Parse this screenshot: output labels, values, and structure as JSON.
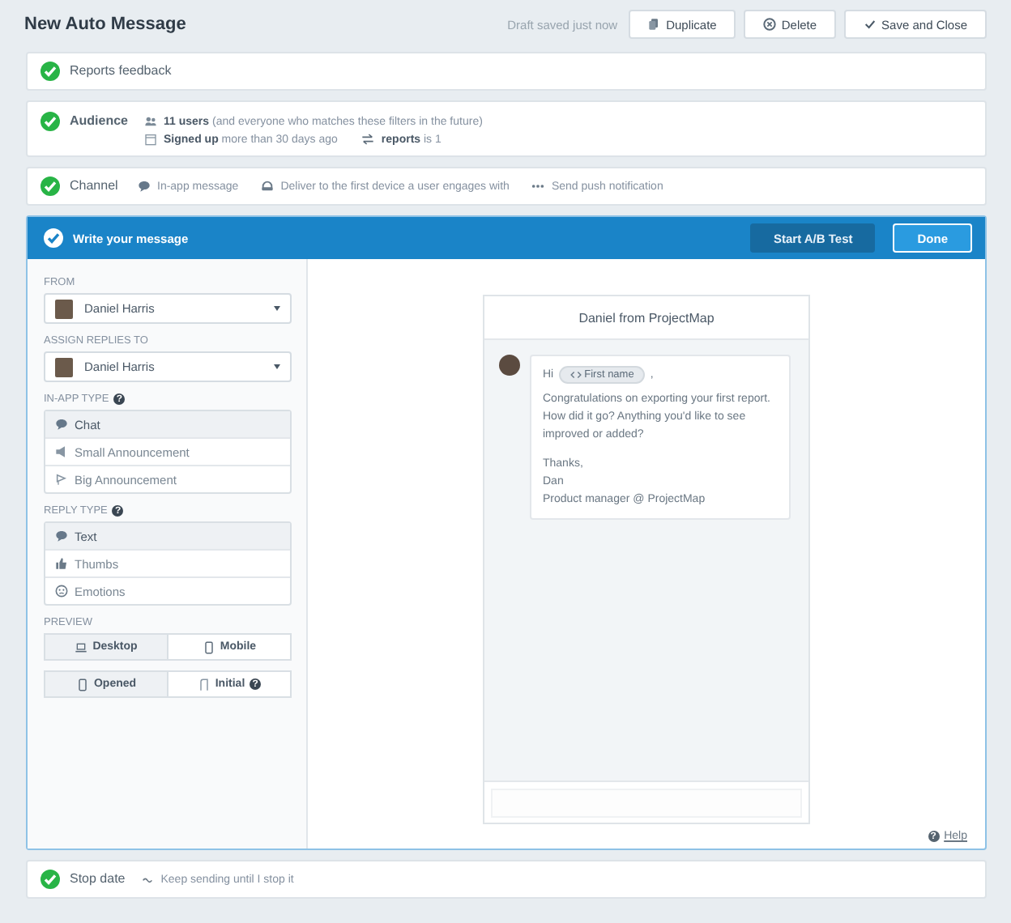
{
  "header": {
    "title": "New Auto Message",
    "draft_status": "Draft saved just now",
    "buttons": [
      {
        "label": "Duplicate",
        "kind": "copy"
      },
      {
        "label": "Delete",
        "kind": "delete"
      },
      {
        "label": "Save and Close",
        "kind": "check"
      }
    ]
  },
  "reports_feedback": {
    "label": "Reports feedback",
    "done": true
  },
  "audience": {
    "label": "Audience",
    "done": true,
    "lines": [
      [
        {
          "kind": "users",
          "text": "**11 users** (and everyone who matches these filters in the future)"
        }
      ],
      [
        {
          "kind": "calendar",
          "text": "**Signed up** more than 30 days ago"
        },
        {
          "kind": "swap",
          "text": "**reports** is 1"
        }
      ]
    ]
  },
  "channel": {
    "label": "Channel",
    "done": true,
    "options": [
      {
        "kind": "chat",
        "text": "In-app message"
      },
      {
        "kind": "device",
        "text": "Deliver to the first device a user engages with"
      },
      {
        "kind": "push",
        "text": "Send push notification"
      }
    ]
  },
  "composer": {
    "title": "Write your message",
    "done": true,
    "buttons": [
      {
        "label": "Start A/B Test",
        "kind": "dark"
      },
      {
        "label": "Done",
        "kind": "primary"
      }
    ],
    "from": {
      "label": "FROM",
      "value": "Daniel Harris"
    },
    "assign": {
      "label": "ASSIGN REPLIES TO",
      "value": "Daniel Harris"
    },
    "in_app_type": {
      "label": "IN-APP TYPE",
      "help": "?",
      "options": [
        {
          "label": "Chat",
          "kind": "chat",
          "selected": true
        },
        {
          "label": "Small Announcement",
          "kind": "megaphone",
          "selected": false
        },
        {
          "label": "Big Announcement",
          "kind": "bigmega",
          "selected": false
        }
      ]
    },
    "reply_type": {
      "label": "REPLY TYPE",
      "help": "?",
      "options": [
        {
          "label": "Text",
          "kind": "chat",
          "selected": true
        },
        {
          "label": "Thumbs",
          "kind": "thumb",
          "selected": false
        },
        {
          "label": "Emotions",
          "kind": "face",
          "selected": false
        }
      ]
    },
    "preview": {
      "label": "PREVIEW",
      "groups": [
        [
          {
            "label": "Desktop",
            "kind": "laptop",
            "selected": true
          },
          {
            "label": "Mobile",
            "kind": "phone",
            "selected": false
          }
        ],
        [
          {
            "label": "Opened",
            "kind": "phone",
            "selected": true
          },
          {
            "label": "Initial",
            "kind": "corner",
            "selected": false,
            "help": "?"
          }
        ]
      ]
    },
    "message": {
      "header": "Daniel from ProjectMap",
      "greeting": "Hi",
      "chip": "First name",
      "after_chip": ",",
      "body": "Congratulations on exporting your first report. How did it go? Anything you'd like to see improved or added?",
      "signature": [
        "Thanks,",
        "Dan",
        "Product manager @ ProjectMap"
      ]
    },
    "help": {
      "symbol": "?",
      "label": "Help"
    }
  },
  "stop_date": {
    "label": "Stop date",
    "done": true,
    "detail": "Keep sending until I stop it"
  }
}
